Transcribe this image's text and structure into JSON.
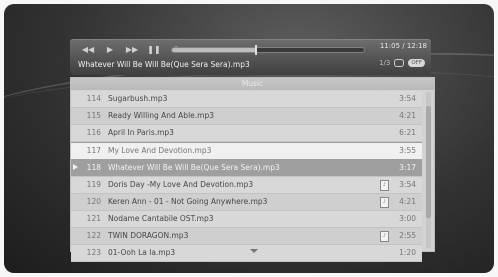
{
  "player": {
    "controls": [
      {
        "icon": "rewind-icon",
        "glyph": "◀◀"
      },
      {
        "icon": "play-icon",
        "glyph": "▶"
      },
      {
        "icon": "fast-forward-icon",
        "glyph": "▶▶"
      },
      {
        "icon": "pause-icon",
        "glyph": "❚❚"
      },
      {
        "icon": "volume-icon",
        "glyph": "♫"
      }
    ],
    "progress": 0.44,
    "time": "11:05 / 12:18",
    "track_title": "Whatever Will Be Will Be(Que Sera Sera).mp3",
    "status_label": "1/3",
    "badge": "OFF"
  },
  "list": {
    "header": "Music",
    "rows": [
      {
        "num": "114",
        "name": "Sugarbush.mp3",
        "duration": "3:54",
        "state": "",
        "file_icon": false
      },
      {
        "num": "115",
        "name": "Ready Willing And Able.mp3",
        "duration": "4:21",
        "state": "alt",
        "file_icon": false
      },
      {
        "num": "116",
        "name": "April In Paris.mp3",
        "duration": "6:21",
        "state": "",
        "file_icon": false
      },
      {
        "num": "117",
        "name": "My Love And Devotion.mp3",
        "duration": "3:55",
        "state": "selected",
        "file_icon": false
      },
      {
        "num": "118",
        "name": "Whatever Will Be Will Be(Que Sera Sera).mp3",
        "duration": "3:17",
        "state": "playing",
        "file_icon": false
      },
      {
        "num": "119",
        "name": "Doris Day -My Love And Devotion.mp3",
        "duration": "3:54",
        "state": "",
        "file_icon": true
      },
      {
        "num": "120",
        "name": "Keren Ann - 01 - Not Going Anywhere.mp3",
        "duration": "4:21",
        "state": "alt",
        "file_icon": true
      },
      {
        "num": "121",
        "name": "Nodame Cantabile OST.mp3",
        "duration": "3:00",
        "state": "",
        "file_icon": false
      },
      {
        "num": "122",
        "name": "TWIN DORAGON.mp3",
        "duration": "2:55",
        "state": "alt",
        "file_icon": true
      },
      {
        "num": "123",
        "name": "01-Ooh La la.mp3",
        "duration": "1:20",
        "state": "",
        "file_icon": false
      }
    ]
  }
}
